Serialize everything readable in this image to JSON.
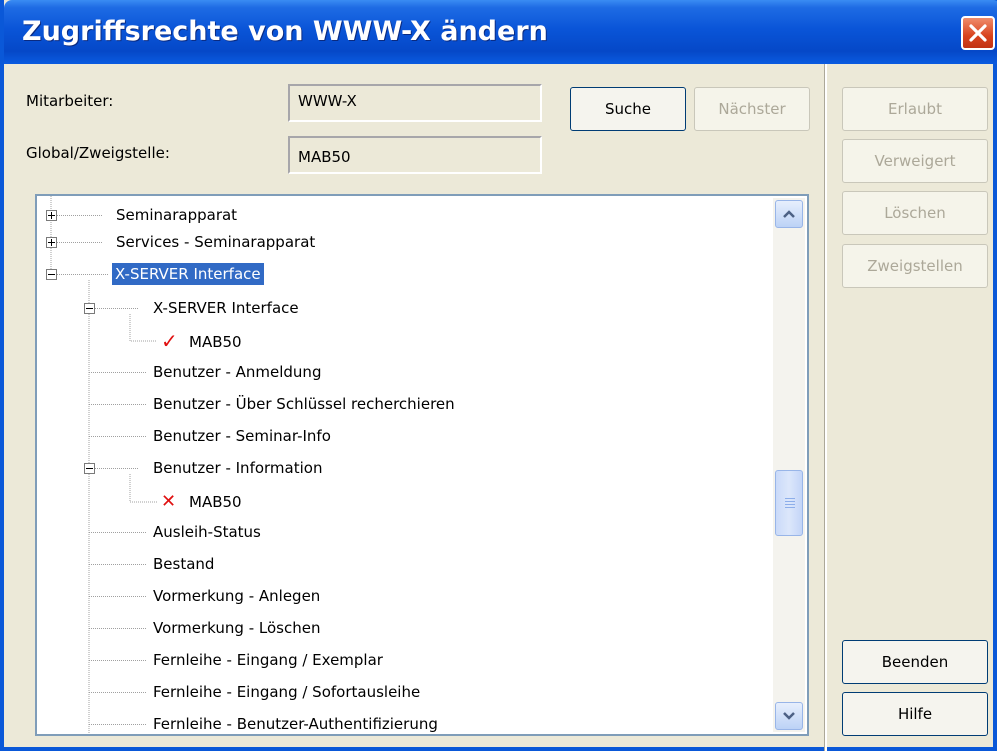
{
  "window": {
    "title": "Zugriffsrechte von WWW-X ändern",
    "close_icon": "close-icon"
  },
  "form": {
    "mitarbeiter_label": "Mitarbeiter:",
    "mitarbeiter_value": "WWW-X",
    "global_label": "Global/Zweigstelle:",
    "global_value": "MAB50",
    "search_label": "Suche",
    "next_label": "Nächster"
  },
  "side_buttons": {
    "erlaubt": "Erlaubt",
    "verweigert": "Verweigert",
    "loeschen": "Löschen",
    "zweigstellen": "Zweigstellen",
    "beenden": "Beenden",
    "hilfe": "Hilfe"
  },
  "tree": {
    "items": [
      {
        "label": "Seminarapparat",
        "state": "collapsed"
      },
      {
        "label": "Services - Seminarapparat",
        "state": "collapsed"
      },
      {
        "label": "X-SERVER Interface",
        "state": "expanded",
        "selected": true
      },
      {
        "label": "X-SERVER Interface",
        "state": "expanded"
      },
      {
        "label": "MAB50",
        "status": "allowed"
      },
      {
        "label": "Benutzer - Anmeldung"
      },
      {
        "label": "Benutzer - Über Schlüssel recherchieren"
      },
      {
        "label": "Benutzer - Seminar-Info"
      },
      {
        "label": "Benutzer - Information",
        "state": "expanded"
      },
      {
        "label": "MAB50",
        "status": "denied"
      },
      {
        "label": "Ausleih-Status"
      },
      {
        "label": "Bestand"
      },
      {
        "label": "Vormerkung - Anlegen"
      },
      {
        "label": "Vormerkung - Löschen"
      },
      {
        "label": "Fernleihe - Eingang / Exemplar"
      },
      {
        "label": "Fernleihe - Eingang / Sofortausleihe"
      },
      {
        "label": "Fernleihe - Benutzer-Authentifizierung"
      }
    ]
  },
  "colors": {
    "titlebar": "#0A55D8",
    "selection": "#316AC5",
    "allowed_mark": "#E01010",
    "denied_mark": "#E01010"
  }
}
